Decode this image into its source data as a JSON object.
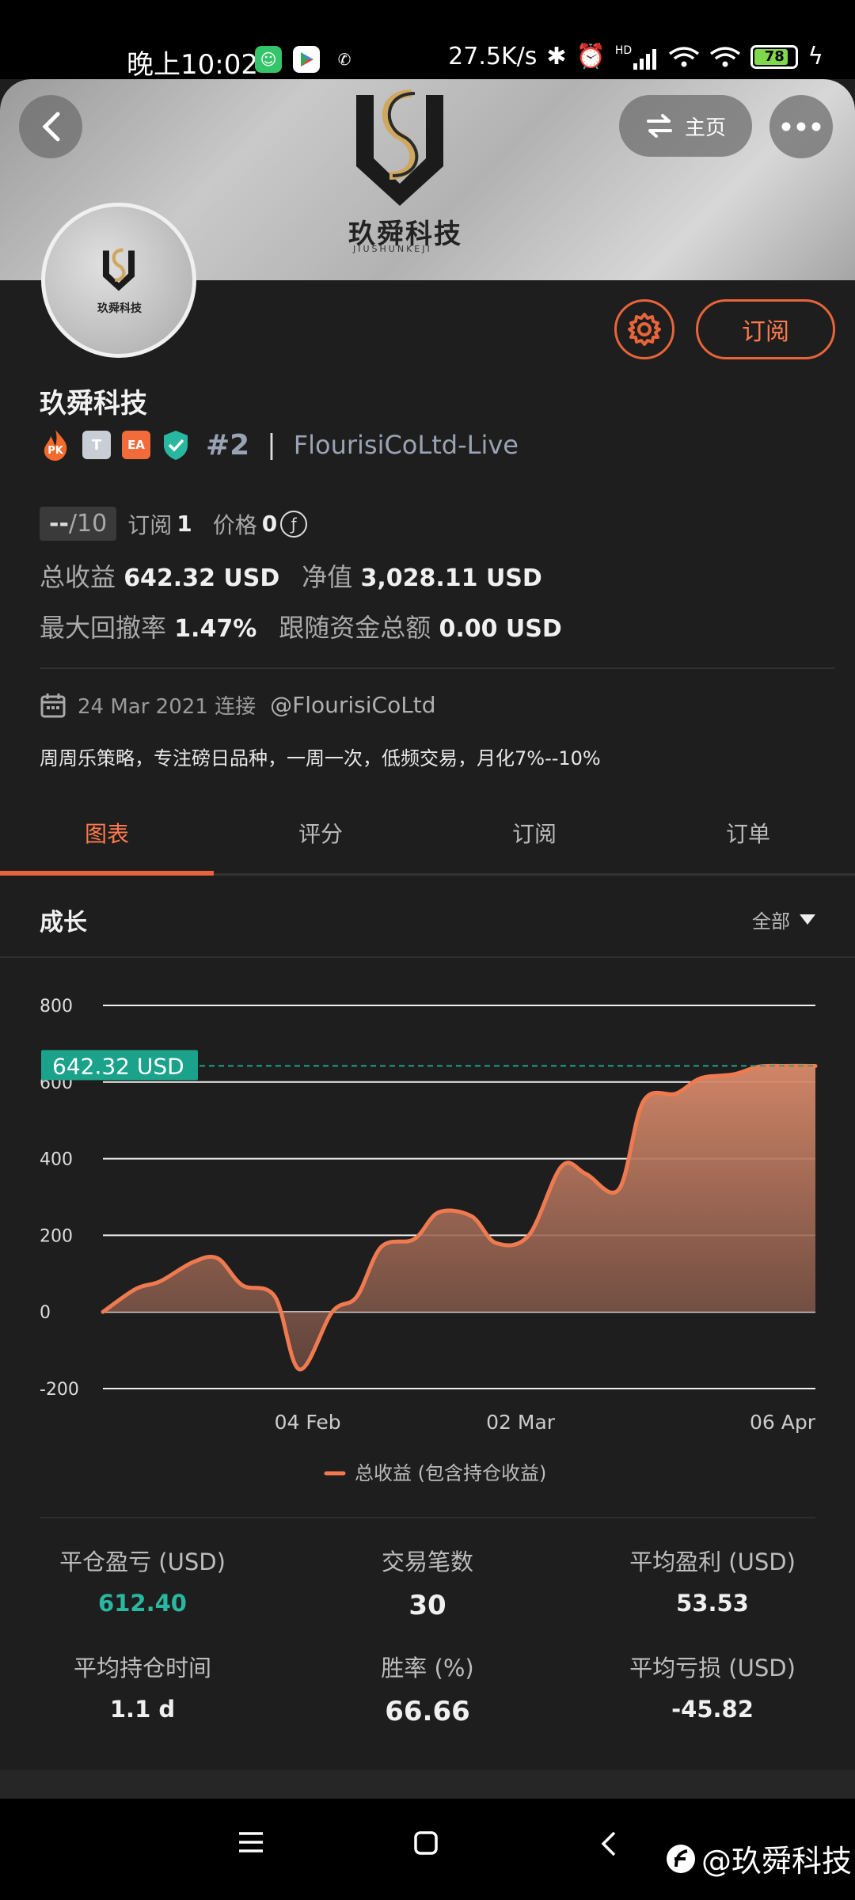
{
  "status_bar": {
    "time": "晚上10:02",
    "net_speed": "27.5K/s",
    "signal_tag": "HD",
    "battery": "78"
  },
  "header": {
    "home_label": "主页",
    "banner_brand": "玖舜科技",
    "banner_sub": "JIUSHUNKEJI"
  },
  "profile": {
    "name": "玖舜科技",
    "badge_pk": "PK",
    "badge_t": "T",
    "badge_ea": "EA",
    "rank": "#2",
    "rank_sep": "|",
    "account": "FlourisiCoLtd-Live",
    "subscribe_label": "订阅",
    "score": "--",
    "score_max": "/10",
    "subs_label": "订阅",
    "subs_value": "1",
    "price_label": "价格",
    "price_value": "0",
    "total_gain_label": "总收益",
    "total_gain_value": "642.32 USD",
    "equity_label": "净值",
    "equity_value": "3,028.11 USD",
    "drawdown_label": "最大回撤率",
    "drawdown_value": "1.47%",
    "follow_label": "跟随资金总额",
    "follow_value": "0.00 USD",
    "connected_date": "24 Mar 2021 连接",
    "handle": "@FlourisiCoLtd",
    "bio": "周周乐策略，专注磅日品种，一周一次，低频交易，月化7%--10%"
  },
  "tabs": [
    {
      "label": "图表",
      "active": true
    },
    {
      "label": "评分",
      "active": false
    },
    {
      "label": "订阅",
      "active": false
    },
    {
      "label": "订单",
      "active": false
    }
  ],
  "growth": {
    "title": "成长",
    "range": "全部"
  },
  "chart_data": {
    "type": "area",
    "x": [
      "2021-01-10",
      "2021-01-14",
      "2021-01-17",
      "2021-01-21",
      "2021-01-24",
      "2021-01-27",
      "2021-01-31",
      "2021-02-03",
      "2021-02-07",
      "2021-02-10",
      "2021-02-13",
      "2021-02-17",
      "2021-02-20",
      "2021-02-24",
      "2021-02-27",
      "2021-03-03",
      "2021-03-07",
      "2021-03-10",
      "2021-03-14",
      "2021-03-17",
      "2021-03-21",
      "2021-03-24",
      "2021-03-28",
      "2021-03-31",
      "2021-04-03",
      "2021-04-07"
    ],
    "series": [
      {
        "name": "总收益 (包含持仓收益)",
        "values": [
          0,
          60,
          80,
          130,
          140,
          70,
          40,
          -150,
          0,
          40,
          170,
          190,
          260,
          250,
          180,
          200,
          380,
          360,
          320,
          550,
          570,
          610,
          620,
          640,
          642,
          642
        ]
      }
    ],
    "y_ticks": [
      "800",
      "600",
      "400",
      "200",
      "0",
      "-200"
    ],
    "x_ticks": [
      "04 Feb",
      "02 Mar",
      "06 Apr"
    ],
    "ylim": [
      -200,
      800
    ],
    "current_label": "642.32 USD",
    "current_value": 642.32,
    "legend": "总收益 (包含持仓收益)",
    "legend_position": "bottom",
    "grid": true,
    "line_color": "#f07a50",
    "marker_color": "#1aa38a"
  },
  "stats": [
    {
      "label": "平仓盈亏 (USD)",
      "value": "612.40",
      "style": "green"
    },
    {
      "label": "交易笔数",
      "value": "30",
      "style": "big"
    },
    {
      "label": "平均盈利 (USD)",
      "value": "53.53",
      "style": ""
    },
    {
      "label": "平均持仓时间",
      "value": "1.1 d",
      "style": ""
    },
    {
      "label": "胜率 (%)",
      "value": "66.66",
      "style": "big"
    },
    {
      "label": "平均亏损 (USD)",
      "value": "-45.82",
      "style": ""
    }
  ],
  "watermark": "@玖舜科技",
  "colors": {
    "accent": "#e8643a",
    "accent_text": "#ff7a4d",
    "green": "#2ab7a0",
    "bg": "#1e1e1e"
  }
}
